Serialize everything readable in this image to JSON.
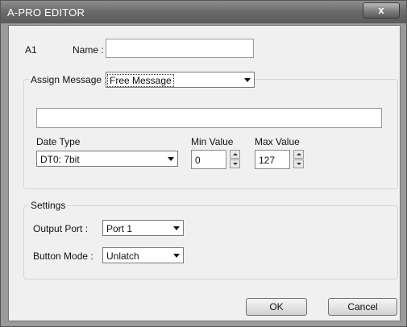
{
  "window": {
    "title": "A-PRO EDITOR",
    "close_symbol": "x"
  },
  "header": {
    "slot_label": "A1",
    "name_label": "Name :",
    "name_value": ""
  },
  "assign": {
    "label": "Assign Message :",
    "message_value": "Free Message",
    "message_text": "",
    "date_type_label": "Date Type",
    "date_type_value": "DT0: 7bit",
    "min_label": "Min Value",
    "min_value": "0",
    "max_label": "Max Value",
    "max_value": "127"
  },
  "settings": {
    "title": "Settings",
    "output_port_label": "Output Port :",
    "output_port_value": "Port 1",
    "button_mode_label": "Button Mode :",
    "button_mode_value": "Unlatch"
  },
  "footer": {
    "ok_label": "OK",
    "cancel_label": "Cancel"
  }
}
